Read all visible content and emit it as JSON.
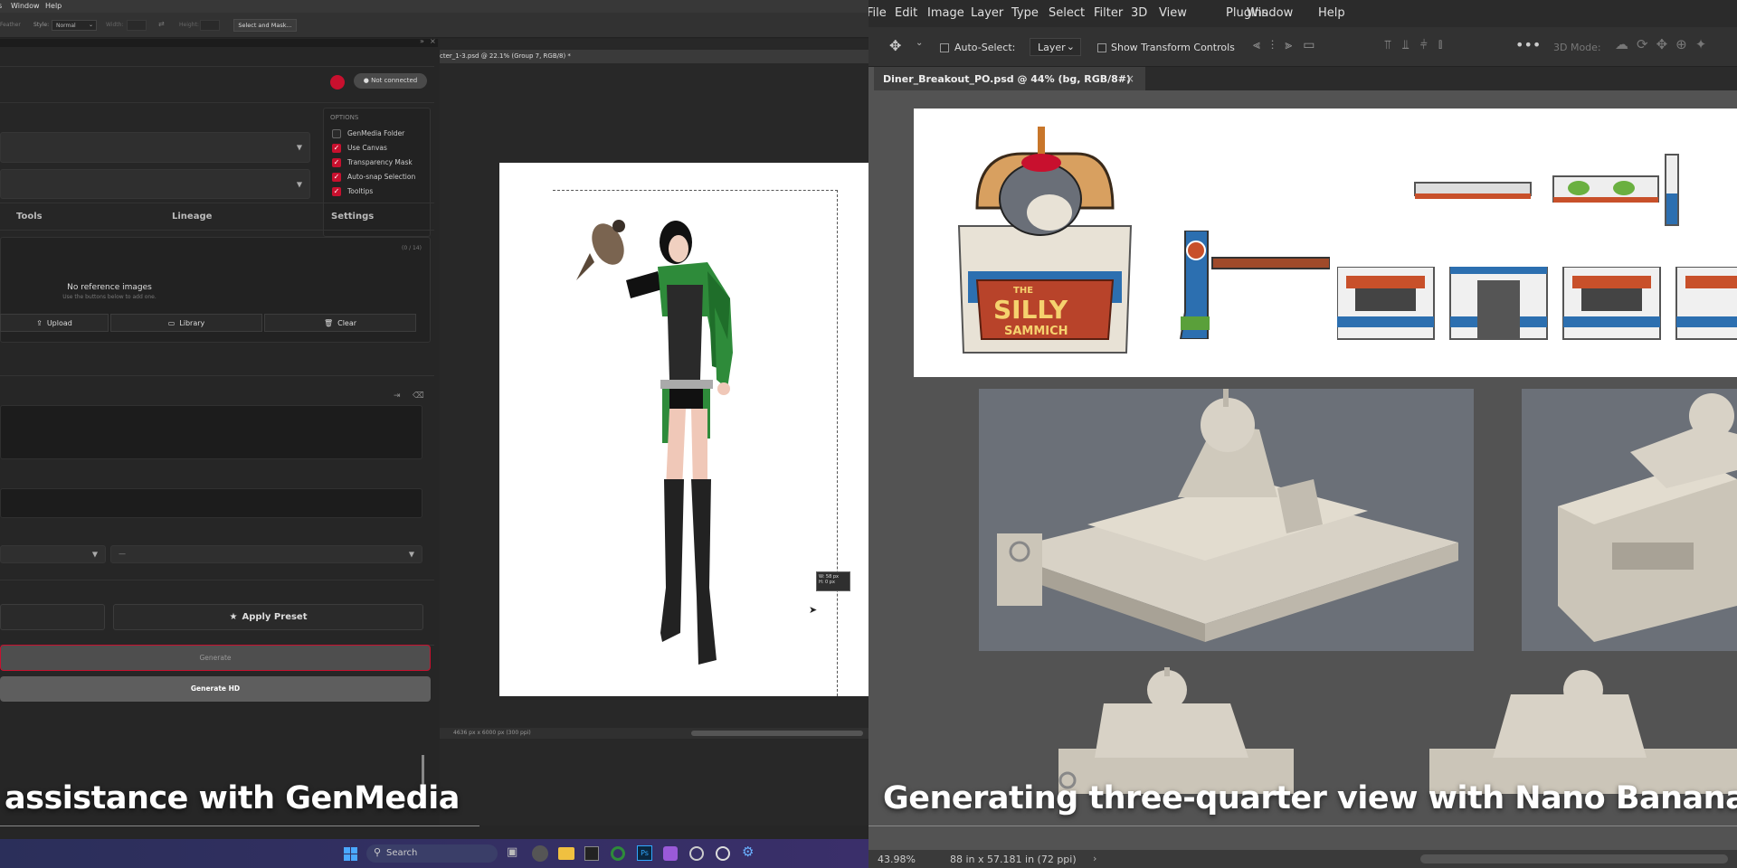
{
  "left_app": {
    "menu": [
      "s",
      "Window",
      "Help"
    ],
    "options_bar": {
      "feather_label": "Feather",
      "style_label": "Style:",
      "style_value": "Normal",
      "width_label": "Width:",
      "height_label": "Height:",
      "select_mask": "Select and Mask..."
    },
    "plugin": {
      "status": "● Not connected",
      "options_title": "OPTIONS",
      "options": [
        {
          "label": "GenMedia Folder",
          "checked": false
        },
        {
          "label": "Use Canvas",
          "checked": true
        },
        {
          "label": "Transparency Mask",
          "checked": true
        },
        {
          "label": "Auto-snap Selection",
          "checked": true
        },
        {
          "label": "Tooltips",
          "checked": true
        }
      ],
      "tabs": [
        "Tools",
        "Lineage",
        "Settings"
      ],
      "ref_count": "(0 / 14)",
      "no_ref_title": "No reference images",
      "no_ref_sub": "Use the buttons below to add one.",
      "upload": "Upload",
      "library": "Library",
      "clear": "Clear",
      "select_dash": "—",
      "apply_preset": "Apply Preset",
      "generate": "Generate",
      "generate_hd": "Generate HD"
    },
    "doc_tab": "cter_1-3.psd @ 22.1% (Group 7, RGB/8) *",
    "measure_w": "W: 58 px",
    "measure_h": "H: 0 px",
    "status": "4636 px x 6000 px (300 ppi)",
    "caption": "assistance with GenMedia"
  },
  "right_app": {
    "menu": [
      "File",
      "Edit",
      "Image",
      "Layer",
      "Type",
      "Select",
      "Filter",
      "3D",
      "View",
      "Plugins",
      "Window",
      "Help"
    ],
    "options_bar": {
      "auto_select": "Auto-Select:",
      "layer_value": "Layer",
      "show_transform": "Show Transform Controls",
      "mode3d": "3D Mode:"
    },
    "doc_tab": "Diner_Breakout_PO.psd @ 44% (bg, RGB/8#)",
    "sign_top": "THE",
    "sign_main": "SILLY",
    "sign_sub": "SAMMICH",
    "zoom": "43.98%",
    "doc_info": "88 in x 57.181 in (72 ppi)",
    "caption": "Generating three-quarter view with Nano Banana Pro"
  },
  "taskbar": {
    "search": "Search"
  },
  "colors": {
    "accent_red": "#c8102e",
    "plugin_bg": "#262626",
    "ps_canvas": "#535353",
    "app_green": "#2e8b3a"
  }
}
